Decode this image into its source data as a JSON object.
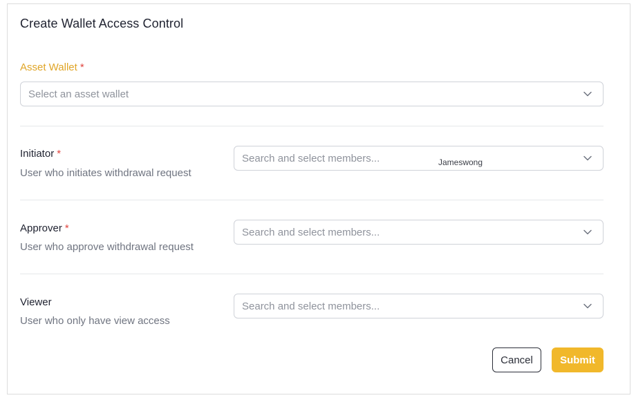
{
  "form": {
    "title": "Create Wallet Access Control",
    "asset_wallet": {
      "label": "Asset Wallet",
      "required_mark": "*",
      "placeholder": "Select an asset wallet"
    },
    "initiator": {
      "label": "Initiator",
      "required_mark": "*",
      "description": "User who initiates withdrawal request",
      "placeholder": "Search and select members...",
      "selected_member": "Jameswong"
    },
    "approver": {
      "label": "Approver",
      "required_mark": "*",
      "description": "User who approve withdrawal request",
      "placeholder": "Search and select members..."
    },
    "viewer": {
      "label": "Viewer",
      "description": "User who only have view access",
      "placeholder": "Search and select members..."
    },
    "actions": {
      "cancel_label": "Cancel",
      "submit_label": "Submit"
    }
  },
  "colors": {
    "accent": "#f1b82b",
    "label_accent": "#e0a526",
    "required": "#e0453f"
  },
  "icons": {
    "dropdown": "chevron-down-icon"
  }
}
